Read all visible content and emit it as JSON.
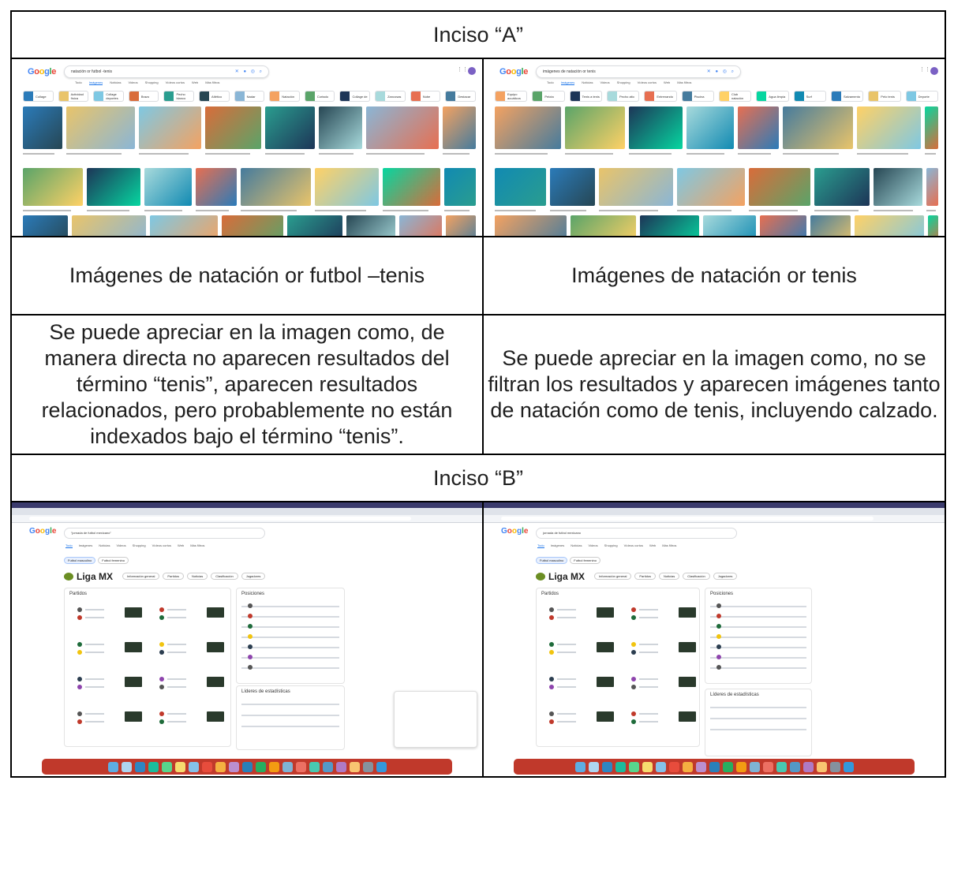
{
  "section_a": {
    "title": "Inciso “A”",
    "left": {
      "query": "natación or futbol -tenis",
      "caption": "Imágenes de natación or futbol –tenis",
      "description": "Se puede apreciar en la imagen como, de manera directa no aparecen resultados del término “tenis”, aparecen resultados relacionados, pero probablemente no están indexados bajo el término “tenis”."
    },
    "right": {
      "query": "imágenes de natación or tenis",
      "caption": "Imágenes de natación or tenis",
      "description": "Se puede apreciar en la imagen como, no se filtran los resultados y aparecen imágenes tanto de natación como de tenis, incluyendo calzado."
    }
  },
  "section_b": {
    "title": "Inciso “B”",
    "left": {
      "query": "“jornada de futbol mexicano”",
      "league": "Liga MX",
      "results_title": "Partidos",
      "standings_title": "Posiciones",
      "leaders_title": "Líderes de estadísticas"
    },
    "right": {
      "query": "jornada de futbol mexicano",
      "league": "Liga MX",
      "results_title": "Partidos",
      "standings_title": "Posiciones",
      "leaders_title": "Líderes de estadísticas"
    }
  },
  "google": {
    "logo": [
      "G",
      "o",
      "o",
      "g",
      "l",
      "e"
    ],
    "tabs_images": [
      "Todo",
      "Imágenes",
      "Noticias",
      "Videos",
      "Shopping",
      "Vídeos cortos",
      "Web",
      "Más filtros"
    ],
    "tabs_all": [
      "Todo",
      "Imágenes",
      "Noticias",
      "Videos",
      "Shopping",
      "Vídeos cortos",
      "Web",
      "Más filtros"
    ],
    "chips_left": [
      "Collage",
      "Actividad física",
      "Collage deportes",
      "Brazo",
      "Pecho blanco",
      "Atlético",
      "Nadar",
      "Natación",
      "Cortado",
      "Collage de",
      "Zancosas",
      "Nube",
      "Destacar"
    ],
    "chips_right": [
      "Equipo acuáticos",
      "Pelota",
      "Tenis a tenis",
      "Pecho alto",
      "Entrenando",
      "Piscina",
      "Club natación",
      "Agua limpia",
      "Surf",
      "Salvamento",
      "Pelo tenis",
      "Deporte"
    ],
    "league_pills": [
      "Información general",
      "Partidos",
      "Noticias",
      "Clasificación",
      "Jugadores"
    ],
    "mode_pills": [
      "Futbol masculino",
      "Futbol femenino"
    ]
  },
  "colors": {
    "border": "#000000",
    "google_blue": "#4285f4",
    "google_red": "#ea4335",
    "google_yellow": "#fbbc05",
    "google_green": "#34a853",
    "dock": "#c0392b"
  }
}
